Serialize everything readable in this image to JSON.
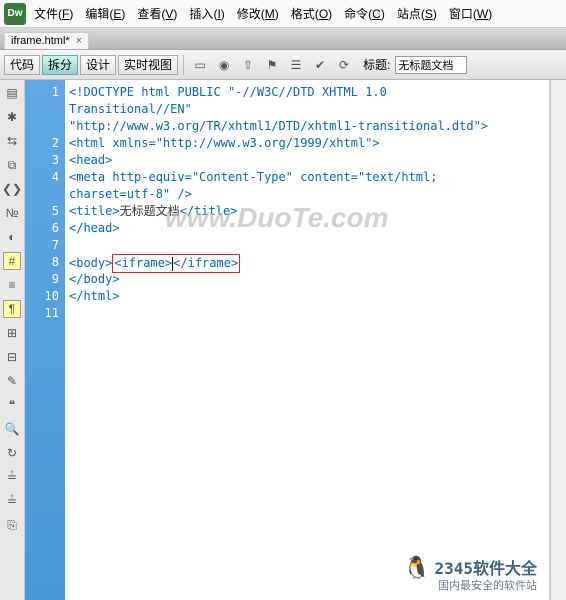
{
  "menu": {
    "items": [
      {
        "label": "文件",
        "key": "F"
      },
      {
        "label": "编辑",
        "key": "E"
      },
      {
        "label": "查看",
        "key": "V"
      },
      {
        "label": "插入",
        "key": "I"
      },
      {
        "label": "修改",
        "key": "M"
      },
      {
        "label": "格式",
        "key": "O"
      },
      {
        "label": "命令",
        "key": "C"
      },
      {
        "label": "站点",
        "key": "S"
      },
      {
        "label": "窗口",
        "key": "W"
      }
    ]
  },
  "logo": "Dw",
  "tab": {
    "name": "iframe.html*",
    "close": "×"
  },
  "toolbar": {
    "views": {
      "code": "代码",
      "split": "拆分",
      "design": "设计",
      "live": "实时视图"
    },
    "title_label": "标题:",
    "title_value": "无标题文档"
  },
  "gutter": [
    "1",
    "2",
    "3",
    "4",
    "5",
    "6",
    "7",
    "8",
    "9",
    "10",
    "11"
  ],
  "code": {
    "l1a": "<!DOCTYPE html PUBLIC \"-//W3C//DTD XHTML 1.0",
    "l1b": "Transitional//EN\"",
    "l1c": "\"http://www.w3.org/TR/xhtml1/DTD/xhtml1-transitional.dtd\">",
    "l2": "<html xmlns=\"http://www.w3.org/1999/xhtml\">",
    "l3": "<head>",
    "l4a": "<meta http-equiv=\"Content-Type\" content=\"text/html;",
    "l4b": "charset=utf-8\" />",
    "l5a": "<title>",
    "l5b": "无标题文档",
    "l5c": "</title>",
    "l6": "</head>",
    "l7": "",
    "l8a": "<body>",
    "l8b": "<iframe>",
    "l8c": "</iframe>",
    "l9": "</body>",
    "l10": "</html>",
    "l11": ""
  },
  "watermark": "www.DuoTe.com",
  "ad": {
    "brand": "2345软件大全",
    "tag": "国内最安全的软件站"
  }
}
